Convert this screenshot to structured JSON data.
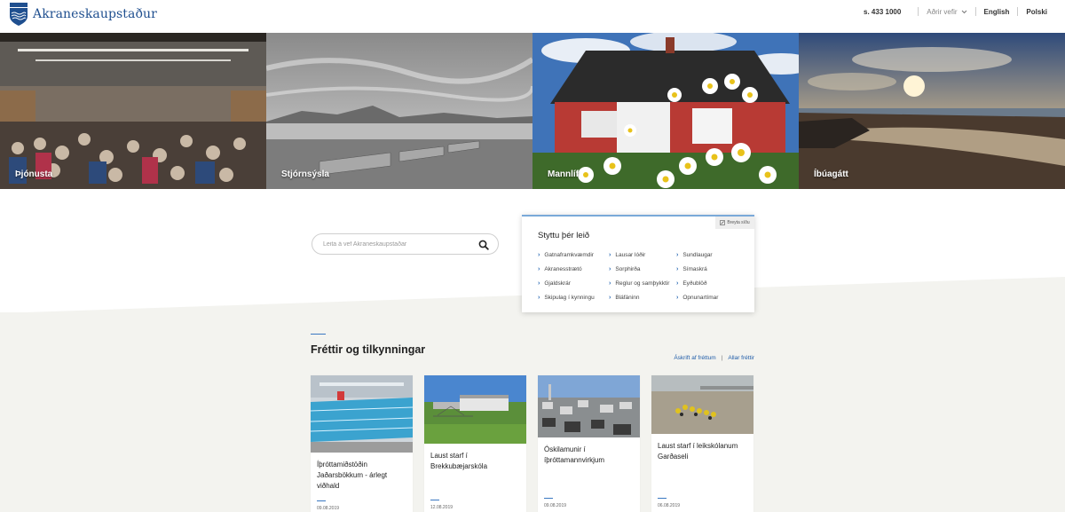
{
  "header": {
    "site_name": "Akraneskaupstaður",
    "phone": "s. 433 1000",
    "other_sites": "Aðrir vefir",
    "lang_en": "English",
    "lang_pl": "Polski"
  },
  "hero": {
    "tiles": [
      {
        "label": "Þjónusta"
      },
      {
        "label": "Stjórnsýsla"
      },
      {
        "label": "Mannlíf"
      },
      {
        "label": "Íbúagátt"
      }
    ]
  },
  "search": {
    "placeholder": "Leita á vef Akraneskaupstaðar"
  },
  "quick_links": {
    "edit_label": "Breyta síðu",
    "title": "Styttu þér leið",
    "columns": [
      [
        "Gatnaframkvæmdir",
        "Akranesstrætó",
        "Gjaldskrár",
        "Skipulag í kynningu"
      ],
      [
        "Lausar lóðir",
        "Sorphirða",
        "Reglur og samþykktir",
        "Bláfáninn"
      ],
      [
        "Sundlaugar",
        "Símaskrá",
        "Eyðublöð",
        "Opnunartímar"
      ]
    ]
  },
  "news": {
    "title": "Fréttir og tilkynningar",
    "subscribe_label": "Áskrift af fréttum",
    "all_label": "Allar fréttir",
    "items": [
      {
        "title": "Íþróttamiðstöðin Jaðarsbökkum - árlegt viðhald",
        "date": "09.08.2019"
      },
      {
        "title": "Laust starf í Brekkubæjarskóla",
        "date": "12.08.2019"
      },
      {
        "title": "Óskilamunir í íþróttamannvirkjum",
        "date": "09.08.2019"
      },
      {
        "title": "Laust starf í leikskólanum Garðaseli",
        "date": "06.08.2019"
      }
    ]
  },
  "colors": {
    "brand": "#1f4f8f",
    "link": "#1f5ca8",
    "accent": "#3a78c2",
    "band": "#f3f3ef"
  }
}
